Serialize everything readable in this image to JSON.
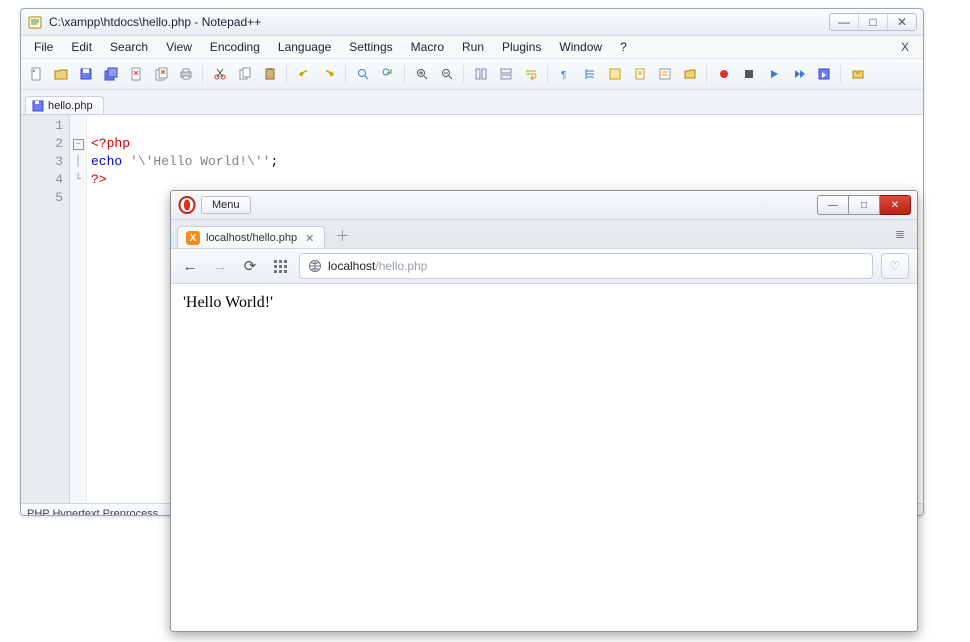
{
  "notepadpp": {
    "title": "C:\\xampp\\htdocs\\hello.php - Notepad++",
    "menu": [
      "File",
      "Edit",
      "Search",
      "View",
      "Encoding",
      "Language",
      "Settings",
      "Macro",
      "Run",
      "Plugins",
      "Window",
      "?"
    ],
    "close_side": "X",
    "tab": {
      "label": "hello.php"
    },
    "gutter": [
      "1",
      "2",
      "3",
      "4",
      "5"
    ],
    "code": {
      "l1": "",
      "l2_tag": "<?php",
      "l3_kw": "echo",
      "l3_sp": " ",
      "l3_str": "'\\'Hello World!\\''",
      "l3_semi": ";",
      "l4_tag": "?>",
      "l5": ""
    },
    "status": "PHP Hypertext Preprocess"
  },
  "browser": {
    "menu_btn": "Menu",
    "tab": {
      "label": "localhost/hello.php"
    },
    "url": {
      "host": "localhost",
      "path": "/hello.php"
    },
    "page_text": "'Hello World!'"
  },
  "icons": {
    "min": "—",
    "max": "□",
    "x": "✕",
    "plus": "＋",
    "heart": "♡",
    "reload": "⟳",
    "grid": "⋮⋮",
    "back": "←",
    "fwd": "→",
    "panels": "≣"
  }
}
